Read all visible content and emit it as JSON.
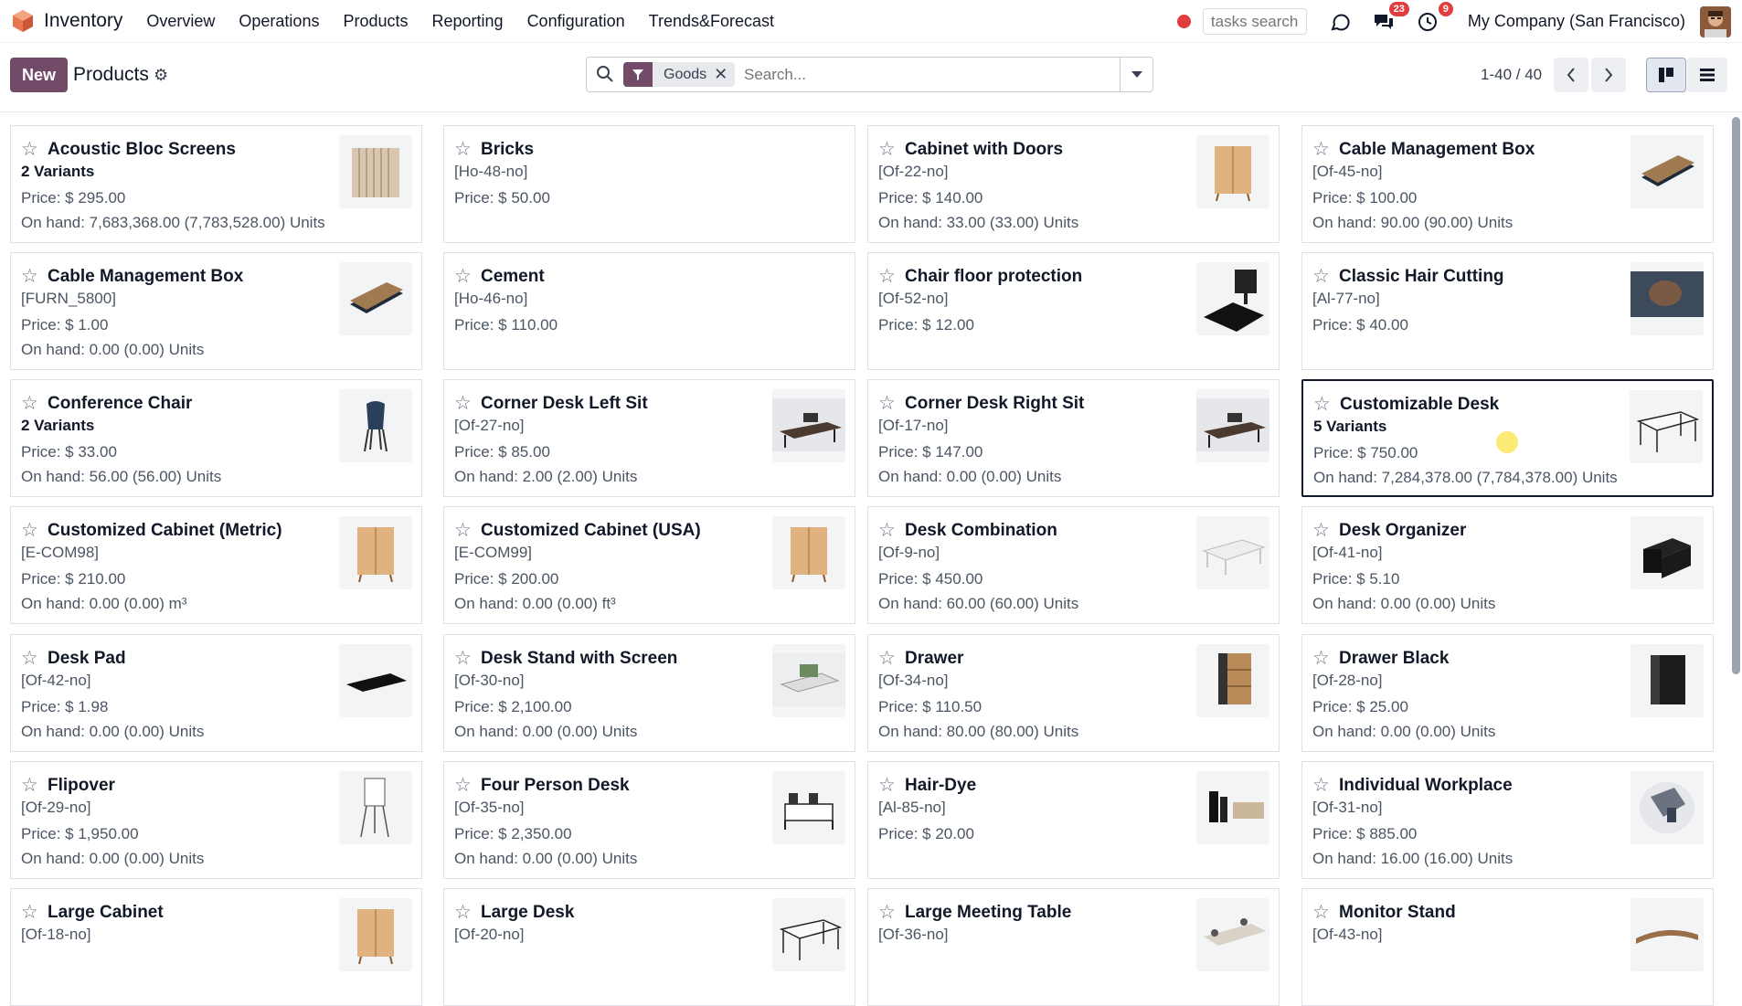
{
  "app": {
    "name": "Inventory"
  },
  "menu": [
    "Overview",
    "Operations",
    "Products",
    "Reporting",
    "Configuration",
    "Trends&Forecast"
  ],
  "topbar": {
    "tasks_placeholder": "tasks search",
    "messages_badge": "23",
    "activities_badge": "9",
    "company": "My Company (San Francisco)"
  },
  "control": {
    "new_label": "New",
    "breadcrumb": "Products",
    "facet_label": "Goods",
    "search_placeholder": "Search...",
    "pager": "1-40 / 40"
  },
  "cards": [
    {
      "name": "Acoustic Bloc Screens",
      "sub": "2 Variants",
      "sub_bold": true,
      "price": "Price: $ 295.00",
      "onhand": "On hand: 7,683,368.00 (7,783,528.00) Units",
      "thumb": "screen"
    },
    {
      "name": "Bricks",
      "sub": "[Ho-48-no]",
      "sub_bold": false,
      "price": "Price: $ 50.00",
      "onhand": "",
      "thumb": ""
    },
    {
      "name": "Cabinet with Doors",
      "sub": "[Of-22-no]",
      "sub_bold": false,
      "price": "Price: $ 140.00",
      "onhand": "On hand: 33.00 (33.00) Units",
      "thumb": "cabinet"
    },
    {
      "name": "Cable Management Box",
      "sub": "[Of-45-no]",
      "sub_bold": false,
      "price": "Price: $ 100.00",
      "onhand": "On hand: 90.00 (90.00) Units",
      "thumb": "cablebox"
    },
    {
      "name": "Cable Management Box",
      "sub": "[FURN_5800]",
      "sub_bold": false,
      "price": "Price: $ 1.00",
      "onhand": "On hand: 0.00 (0.00) Units",
      "thumb": "cablebox"
    },
    {
      "name": "Cement",
      "sub": "[Ho-46-no]",
      "sub_bold": false,
      "price": "Price: $ 110.00",
      "onhand": "",
      "thumb": ""
    },
    {
      "name": "Chair floor protection",
      "sub": "[Of-52-no]",
      "sub_bold": false,
      "price": "Price: $ 12.00",
      "onhand": "",
      "thumb": "floormat"
    },
    {
      "name": "Classic Hair Cutting",
      "sub": "[Al-77-no]",
      "sub_bold": false,
      "price": "Price: $ 40.00",
      "onhand": "",
      "thumb": "hair"
    },
    {
      "name": "Conference Chair",
      "sub": "2 Variants",
      "sub_bold": true,
      "price": "Price: $ 33.00",
      "onhand": "On hand: 56.00 (56.00) Units",
      "thumb": "chair"
    },
    {
      "name": "Corner Desk Left Sit",
      "sub": "[Of-27-no]",
      "sub_bold": false,
      "price": "Price: $ 85.00",
      "onhand": "On hand: 2.00 (2.00) Units",
      "thumb": "cornerdesk"
    },
    {
      "name": "Corner Desk Right Sit",
      "sub": "[Of-17-no]",
      "sub_bold": false,
      "price": "Price: $ 147.00",
      "onhand": "On hand: 0.00 (0.00) Units",
      "thumb": "cornerdesk"
    },
    {
      "name": "Customizable Desk",
      "sub": "5 Variants",
      "sub_bold": true,
      "price": "Price: $ 750.00",
      "onhand": "On hand: 7,284,378.00 (7,784,378.00) Units",
      "thumb": "desk",
      "selected": true
    },
    {
      "name": "Customized Cabinet (Metric)",
      "sub": "[E-COM98]",
      "sub_bold": false,
      "price": "Price: $ 210.00",
      "onhand": "On hand: 0.00 (0.00) m³",
      "thumb": "cabinet"
    },
    {
      "name": "Customized Cabinet (USA)",
      "sub": "[E-COM99]",
      "sub_bold": false,
      "price": "Price: $ 200.00",
      "onhand": "On hand: 0.00 (0.00) ft³",
      "thumb": "cabinet"
    },
    {
      "name": "Desk Combination",
      "sub": "[Of-9-no]",
      "sub_bold": false,
      "price": "Price: $ 450.00",
      "onhand": "On hand: 60.00 (60.00) Units",
      "thumb": "deskcombo"
    },
    {
      "name": "Desk Organizer",
      "sub": "[Of-41-no]",
      "sub_bold": false,
      "price": "Price: $ 5.10",
      "onhand": "On hand: 0.00 (0.00) Units",
      "thumb": "organizer"
    },
    {
      "name": "Desk Pad",
      "sub": "[Of-42-no]",
      "sub_bold": false,
      "price": "Price: $ 1.98",
      "onhand": "On hand: 0.00 (0.00) Units",
      "thumb": "deskpad"
    },
    {
      "name": "Desk Stand with Screen",
      "sub": "[Of-30-no]",
      "sub_bold": false,
      "price": "Price: $ 2,100.00",
      "onhand": "On hand: 0.00 (0.00) Units",
      "thumb": "deskstand"
    },
    {
      "name": "Drawer",
      "sub": "[Of-34-no]",
      "sub_bold": false,
      "price": "Price: $ 110.50",
      "onhand": "On hand: 80.00 (80.00) Units",
      "thumb": "drawer"
    },
    {
      "name": "Drawer Black",
      "sub": "[Of-28-no]",
      "sub_bold": false,
      "price": "Price: $ 25.00",
      "onhand": "On hand: 0.00 (0.00) Units",
      "thumb": "drawerblack"
    },
    {
      "name": "Flipover",
      "sub": "[Of-29-no]",
      "sub_bold": false,
      "price": "Price: $ 1,950.00",
      "onhand": "On hand: 0.00 (0.00) Units",
      "thumb": "flipover"
    },
    {
      "name": "Four Person Desk",
      "sub": "[Of-35-no]",
      "sub_bold": false,
      "price": "Price: $ 2,350.00",
      "onhand": "On hand: 0.00 (0.00) Units",
      "thumb": "fourdesk"
    },
    {
      "name": "Hair-Dye",
      "sub": "[Al-85-no]",
      "sub_bold": false,
      "price": "Price: $ 20.00",
      "onhand": "",
      "thumb": "hairdye"
    },
    {
      "name": "Individual Workplace",
      "sub": "[Of-31-no]",
      "sub_bold": false,
      "price": "Price: $ 885.00",
      "onhand": "On hand: 16.00 (16.00) Units",
      "thumb": "workplace"
    },
    {
      "name": "Large Cabinet",
      "sub": "[Of-18-no]",
      "sub_bold": false,
      "price": "",
      "onhand": "",
      "thumb": "cabinet"
    },
    {
      "name": "Large Desk",
      "sub": "[Of-20-no]",
      "sub_bold": false,
      "price": "",
      "onhand": "",
      "thumb": "desk"
    },
    {
      "name": "Large Meeting Table",
      "sub": "[Of-36-no]",
      "sub_bold": false,
      "price": "",
      "onhand": "",
      "thumb": "meeting"
    },
    {
      "name": "Monitor Stand",
      "sub": "[Of-43-no]",
      "sub_bold": false,
      "price": "",
      "onhand": "",
      "thumb": "monitorstand"
    }
  ]
}
